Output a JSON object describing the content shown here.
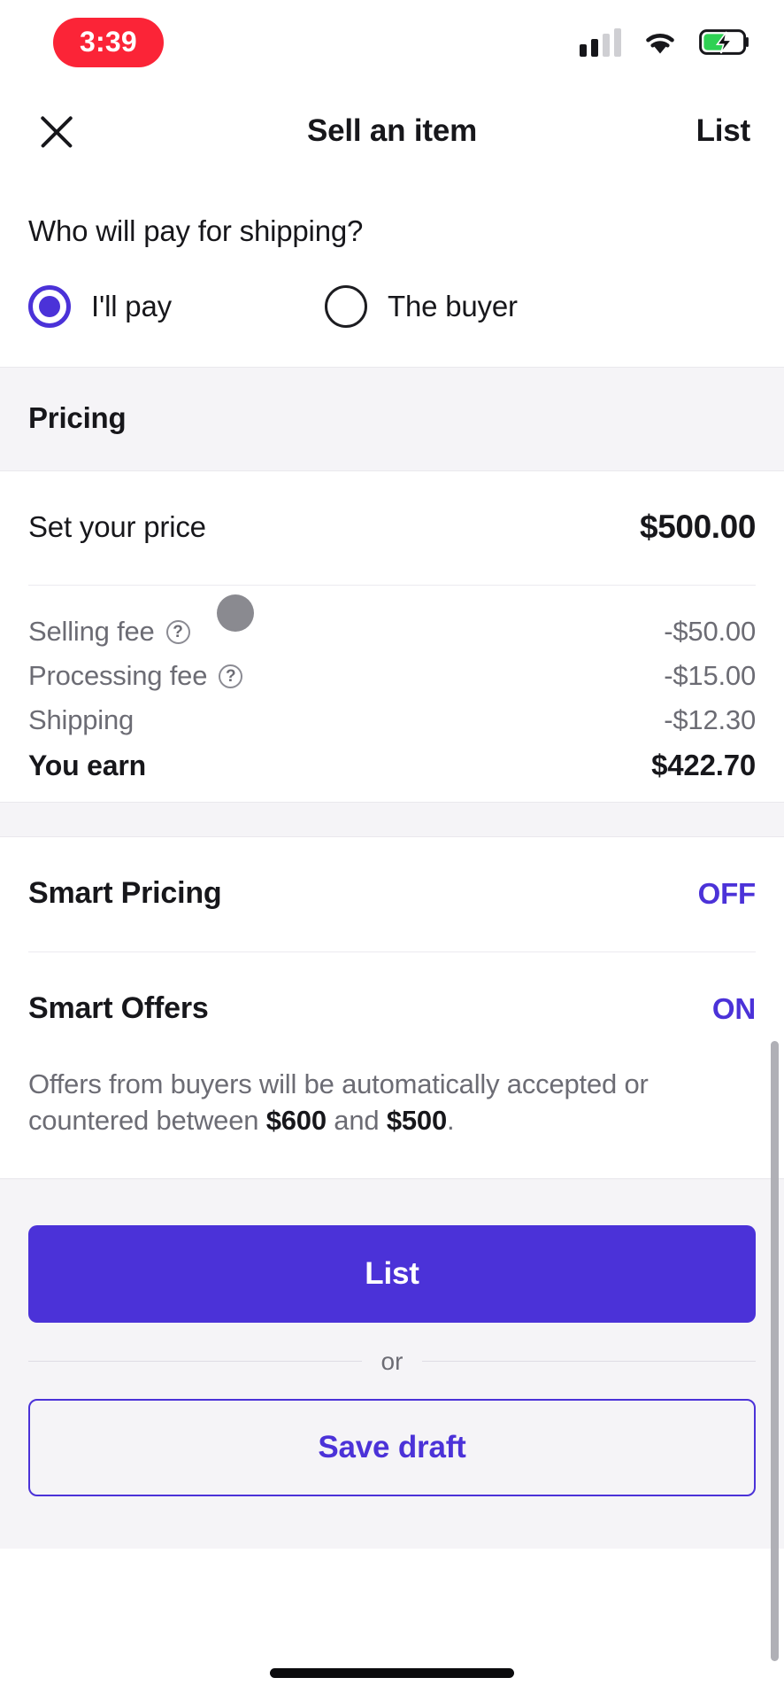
{
  "status_bar": {
    "time": "3:39",
    "time_pill_color": "#fb2437",
    "signal_icon": "cellular-signal-icon",
    "signal_bars_filled": 2,
    "signal_bars_total": 4,
    "wifi_icon": "wifi-icon",
    "battery_icon": "battery-charging-icon",
    "battery_color": "#2fd154"
  },
  "navbar": {
    "close_icon": "close-icon",
    "title": "Sell an item",
    "action_label": "List"
  },
  "shipping": {
    "question": "Who will pay for shipping?",
    "options": [
      {
        "label": "I'll pay",
        "selected": true
      },
      {
        "label": "The buyer",
        "selected": false
      }
    ],
    "accent": "#4b32d8"
  },
  "pricing": {
    "section_title": "Pricing",
    "set_price_label": "Set your price",
    "set_price_value": "$500.00",
    "fees": [
      {
        "name": "Selling fee",
        "help": "?",
        "value": "-$50.00",
        "has_help": true
      },
      {
        "name": "Processing fee",
        "help": "?",
        "value": "-$15.00",
        "has_help": true
      },
      {
        "name": "Shipping",
        "value": "-$12.30",
        "has_help": false
      }
    ],
    "total_label": "You earn",
    "total_value": "$422.70"
  },
  "smart_pricing": {
    "title": "Smart Pricing",
    "state": "OFF"
  },
  "smart_offers": {
    "title": "Smart Offers",
    "state": "ON",
    "description_prefix": "Offers from buyers will be automatically accepted or countered between ",
    "amount_high": "$600",
    "description_middle": " and ",
    "amount_low": "$500",
    "description_suffix": "."
  },
  "footer": {
    "primary_label": "List",
    "or_label": "or",
    "secondary_label": "Save draft"
  }
}
